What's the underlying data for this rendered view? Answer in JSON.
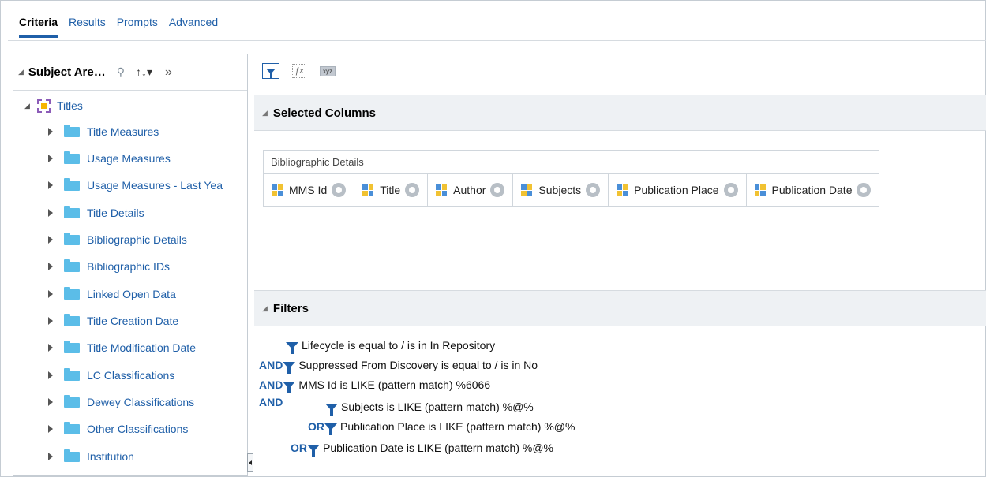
{
  "tabs": [
    {
      "label": "Criteria",
      "active": true
    },
    {
      "label": "Results",
      "active": false
    },
    {
      "label": "Prompts",
      "active": false
    },
    {
      "label": "Advanced",
      "active": false
    }
  ],
  "subject_area": {
    "title": "Subject Are…",
    "root": "Titles",
    "folders": [
      "Title Measures",
      "Usage Measures",
      "Usage Measures - Last Yea",
      "Title Details",
      "Bibliographic Details",
      "Bibliographic IDs",
      "Linked Open Data",
      "Title Creation Date",
      "Title Modification Date",
      "LC Classifications",
      "Dewey Classifications",
      "Other Classifications",
      "Institution"
    ]
  },
  "toolbar": {
    "filter_icon": "filter-icon",
    "formula_icon": "formula-icon",
    "xyz_label": "xyz"
  },
  "selected_columns": {
    "title": "Selected Columns",
    "group_caption": "Bibliographic Details",
    "columns": [
      "MMS Id",
      "Title",
      "Author",
      "Subjects",
      "Publication Place",
      "Publication Date"
    ]
  },
  "filters": {
    "title": "Filters",
    "rows": [
      {
        "op": "",
        "text": "Lifecycle is equal to / is in  In Repository"
      },
      {
        "op": "AND",
        "text": "Suppressed From Discovery is equal to / is in  No"
      },
      {
        "op": "AND",
        "text": "MMS Id  is LIKE (pattern match) %6066"
      },
      {
        "op": "AND",
        "text": ""
      },
      {
        "op": "",
        "text": "Subjects  is LIKE (pattern match) %@%"
      },
      {
        "op": "OR",
        "text": "Publication Place  is LIKE (pattern match) %@%"
      },
      {
        "op": "OR",
        "text": "Publication Date  is LIKE (pattern match) %@%"
      }
    ]
  },
  "colors": {
    "accent": "#1f5fa8",
    "folder": "#5bbde8",
    "section_bg": "#eef1f4"
  }
}
